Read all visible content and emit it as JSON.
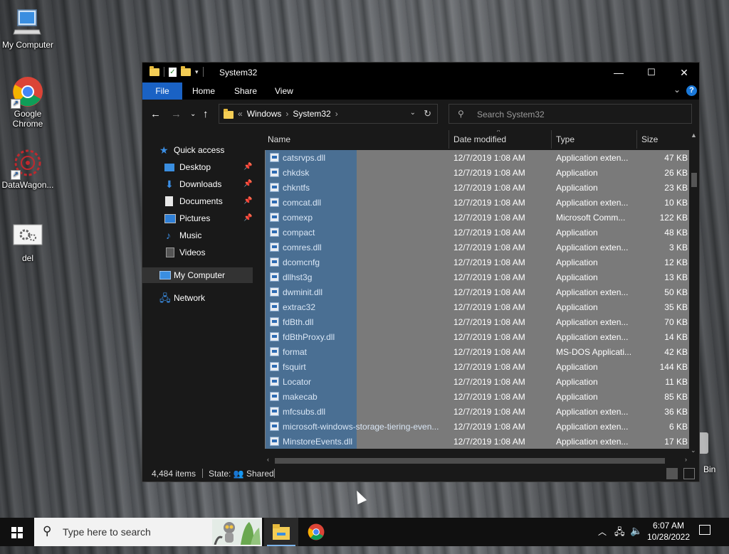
{
  "desktop": {
    "icons": [
      {
        "label": "My Computer"
      },
      {
        "label": "Google Chrome"
      },
      {
        "label": "DataWagon..."
      },
      {
        "label": "del"
      }
    ],
    "recycle_bin_partial": "Bin"
  },
  "window": {
    "title": "System32",
    "controls": {
      "minimize": "—",
      "maximize": "☐",
      "close": "✕"
    },
    "ribbon_tabs": [
      "File",
      "Home",
      "Share",
      "View"
    ],
    "address": {
      "prefix": "«",
      "crumbs": [
        "Windows",
        "System32"
      ],
      "sep": "›"
    },
    "search_placeholder": "Search System32",
    "nav": {
      "quick_access": "Quick access",
      "items": [
        {
          "label": "Desktop",
          "pinned": true
        },
        {
          "label": "Downloads",
          "pinned": true
        },
        {
          "label": "Documents",
          "pinned": true
        },
        {
          "label": "Pictures",
          "pinned": true
        },
        {
          "label": "Music",
          "pinned": false
        },
        {
          "label": "Videos",
          "pinned": false
        }
      ],
      "my_computer": "My Computer",
      "network": "Network"
    },
    "columns": {
      "name": "Name",
      "date": "Date modified",
      "type": "Type",
      "size": "Size"
    },
    "files": [
      {
        "name": "catsrvps.dll",
        "date": "12/7/2019 1:08 AM",
        "type": "Application exten...",
        "size": "47 KB"
      },
      {
        "name": "chkdsk",
        "date": "12/7/2019 1:08 AM",
        "type": "Application",
        "size": "26 KB"
      },
      {
        "name": "chkntfs",
        "date": "12/7/2019 1:08 AM",
        "type": "Application",
        "size": "23 KB"
      },
      {
        "name": "comcat.dll",
        "date": "12/7/2019 1:08 AM",
        "type": "Application exten...",
        "size": "10 KB"
      },
      {
        "name": "comexp",
        "date": "12/7/2019 1:08 AM",
        "type": "Microsoft Comm...",
        "size": "122 KB"
      },
      {
        "name": "compact",
        "date": "12/7/2019 1:08 AM",
        "type": "Application",
        "size": "48 KB"
      },
      {
        "name": "comres.dll",
        "date": "12/7/2019 1:08 AM",
        "type": "Application exten...",
        "size": "3 KB"
      },
      {
        "name": "dcomcnfg",
        "date": "12/7/2019 1:08 AM",
        "type": "Application",
        "size": "12 KB"
      },
      {
        "name": "dllhst3g",
        "date": "12/7/2019 1:08 AM",
        "type": "Application",
        "size": "13 KB"
      },
      {
        "name": "dwminit.dll",
        "date": "12/7/2019 1:08 AM",
        "type": "Application exten...",
        "size": "50 KB"
      },
      {
        "name": "extrac32",
        "date": "12/7/2019 1:08 AM",
        "type": "Application",
        "size": "35 KB"
      },
      {
        "name": "fdBth.dll",
        "date": "12/7/2019 1:08 AM",
        "type": "Application exten...",
        "size": "70 KB"
      },
      {
        "name": "fdBthProxy.dll",
        "date": "12/7/2019 1:08 AM",
        "type": "Application exten...",
        "size": "14 KB"
      },
      {
        "name": "format",
        "date": "12/7/2019 1:08 AM",
        "type": "MS-DOS Applicati...",
        "size": "42 KB"
      },
      {
        "name": "fsquirt",
        "date": "12/7/2019 1:08 AM",
        "type": "Application",
        "size": "144 KB"
      },
      {
        "name": "Locator",
        "date": "12/7/2019 1:08 AM",
        "type": "Application",
        "size": "11 KB"
      },
      {
        "name": "makecab",
        "date": "12/7/2019 1:08 AM",
        "type": "Application",
        "size": "85 KB"
      },
      {
        "name": "mfcsubs.dll",
        "date": "12/7/2019 1:08 AM",
        "type": "Application exten...",
        "size": "36 KB"
      },
      {
        "name": "microsoft-windows-storage-tiering-even...",
        "date": "12/7/2019 1:08 AM",
        "type": "Application exten...",
        "size": "6 KB"
      },
      {
        "name": "MinstoreEvents.dll",
        "date": "12/7/2019 1:08 AM",
        "type": "Application exten...",
        "size": "17 KB"
      }
    ],
    "status": {
      "count": "4,484 items",
      "state": "State:",
      "shared": "Shared"
    }
  },
  "taskbar": {
    "search_placeholder": "Type here to search",
    "time": "6:07 AM",
    "date": "10/28/2022"
  },
  "colors": {
    "accent": "#1a62c4",
    "selection": "#4a6f93",
    "row_bg": "#7a7a7a"
  }
}
